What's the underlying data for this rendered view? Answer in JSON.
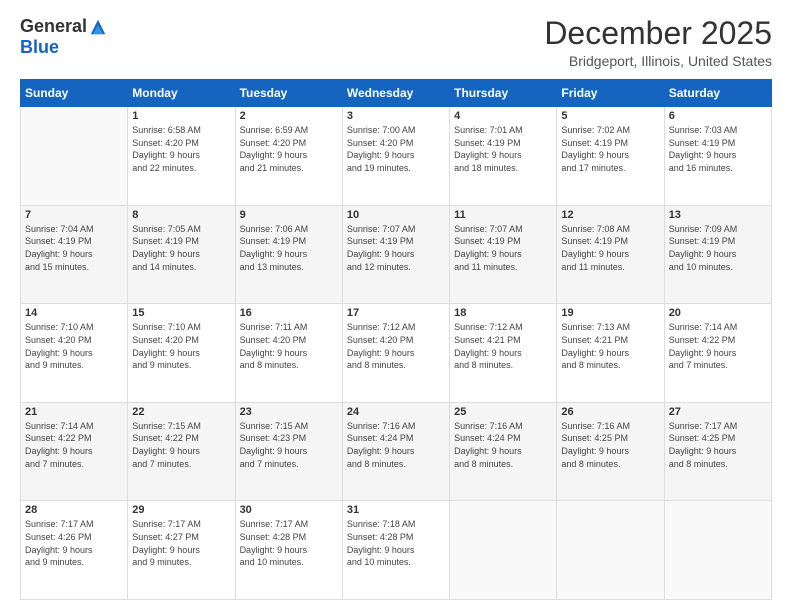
{
  "header": {
    "logo_general": "General",
    "logo_blue": "Blue",
    "title": "December 2025",
    "subtitle": "Bridgeport, Illinois, United States"
  },
  "days_of_week": [
    "Sunday",
    "Monday",
    "Tuesday",
    "Wednesday",
    "Thursday",
    "Friday",
    "Saturday"
  ],
  "weeks": [
    [
      {
        "day": "",
        "info": ""
      },
      {
        "day": "1",
        "info": "Sunrise: 6:58 AM\nSunset: 4:20 PM\nDaylight: 9 hours\nand 22 minutes."
      },
      {
        "day": "2",
        "info": "Sunrise: 6:59 AM\nSunset: 4:20 PM\nDaylight: 9 hours\nand 21 minutes."
      },
      {
        "day": "3",
        "info": "Sunrise: 7:00 AM\nSunset: 4:20 PM\nDaylight: 9 hours\nand 19 minutes."
      },
      {
        "day": "4",
        "info": "Sunrise: 7:01 AM\nSunset: 4:19 PM\nDaylight: 9 hours\nand 18 minutes."
      },
      {
        "day": "5",
        "info": "Sunrise: 7:02 AM\nSunset: 4:19 PM\nDaylight: 9 hours\nand 17 minutes."
      },
      {
        "day": "6",
        "info": "Sunrise: 7:03 AM\nSunset: 4:19 PM\nDaylight: 9 hours\nand 16 minutes."
      }
    ],
    [
      {
        "day": "7",
        "info": "Sunrise: 7:04 AM\nSunset: 4:19 PM\nDaylight: 9 hours\nand 15 minutes."
      },
      {
        "day": "8",
        "info": "Sunrise: 7:05 AM\nSunset: 4:19 PM\nDaylight: 9 hours\nand 14 minutes."
      },
      {
        "day": "9",
        "info": "Sunrise: 7:06 AM\nSunset: 4:19 PM\nDaylight: 9 hours\nand 13 minutes."
      },
      {
        "day": "10",
        "info": "Sunrise: 7:07 AM\nSunset: 4:19 PM\nDaylight: 9 hours\nand 12 minutes."
      },
      {
        "day": "11",
        "info": "Sunrise: 7:07 AM\nSunset: 4:19 PM\nDaylight: 9 hours\nand 11 minutes."
      },
      {
        "day": "12",
        "info": "Sunrise: 7:08 AM\nSunset: 4:19 PM\nDaylight: 9 hours\nand 11 minutes."
      },
      {
        "day": "13",
        "info": "Sunrise: 7:09 AM\nSunset: 4:19 PM\nDaylight: 9 hours\nand 10 minutes."
      }
    ],
    [
      {
        "day": "14",
        "info": "Sunrise: 7:10 AM\nSunset: 4:20 PM\nDaylight: 9 hours\nand 9 minutes."
      },
      {
        "day": "15",
        "info": "Sunrise: 7:10 AM\nSunset: 4:20 PM\nDaylight: 9 hours\nand 9 minutes."
      },
      {
        "day": "16",
        "info": "Sunrise: 7:11 AM\nSunset: 4:20 PM\nDaylight: 9 hours\nand 8 minutes."
      },
      {
        "day": "17",
        "info": "Sunrise: 7:12 AM\nSunset: 4:20 PM\nDaylight: 9 hours\nand 8 minutes."
      },
      {
        "day": "18",
        "info": "Sunrise: 7:12 AM\nSunset: 4:21 PM\nDaylight: 9 hours\nand 8 minutes."
      },
      {
        "day": "19",
        "info": "Sunrise: 7:13 AM\nSunset: 4:21 PM\nDaylight: 9 hours\nand 8 minutes."
      },
      {
        "day": "20",
        "info": "Sunrise: 7:14 AM\nSunset: 4:22 PM\nDaylight: 9 hours\nand 7 minutes."
      }
    ],
    [
      {
        "day": "21",
        "info": "Sunrise: 7:14 AM\nSunset: 4:22 PM\nDaylight: 9 hours\nand 7 minutes."
      },
      {
        "day": "22",
        "info": "Sunrise: 7:15 AM\nSunset: 4:22 PM\nDaylight: 9 hours\nand 7 minutes."
      },
      {
        "day": "23",
        "info": "Sunrise: 7:15 AM\nSunset: 4:23 PM\nDaylight: 9 hours\nand 7 minutes."
      },
      {
        "day": "24",
        "info": "Sunrise: 7:16 AM\nSunset: 4:24 PM\nDaylight: 9 hours\nand 8 minutes."
      },
      {
        "day": "25",
        "info": "Sunrise: 7:16 AM\nSunset: 4:24 PM\nDaylight: 9 hours\nand 8 minutes."
      },
      {
        "day": "26",
        "info": "Sunrise: 7:16 AM\nSunset: 4:25 PM\nDaylight: 9 hours\nand 8 minutes."
      },
      {
        "day": "27",
        "info": "Sunrise: 7:17 AM\nSunset: 4:25 PM\nDaylight: 9 hours\nand 8 minutes."
      }
    ],
    [
      {
        "day": "28",
        "info": "Sunrise: 7:17 AM\nSunset: 4:26 PM\nDaylight: 9 hours\nand 9 minutes."
      },
      {
        "day": "29",
        "info": "Sunrise: 7:17 AM\nSunset: 4:27 PM\nDaylight: 9 hours\nand 9 minutes."
      },
      {
        "day": "30",
        "info": "Sunrise: 7:17 AM\nSunset: 4:28 PM\nDaylight: 9 hours\nand 10 minutes."
      },
      {
        "day": "31",
        "info": "Sunrise: 7:18 AM\nSunset: 4:28 PM\nDaylight: 9 hours\nand 10 minutes."
      },
      {
        "day": "",
        "info": ""
      },
      {
        "day": "",
        "info": ""
      },
      {
        "day": "",
        "info": ""
      }
    ]
  ]
}
